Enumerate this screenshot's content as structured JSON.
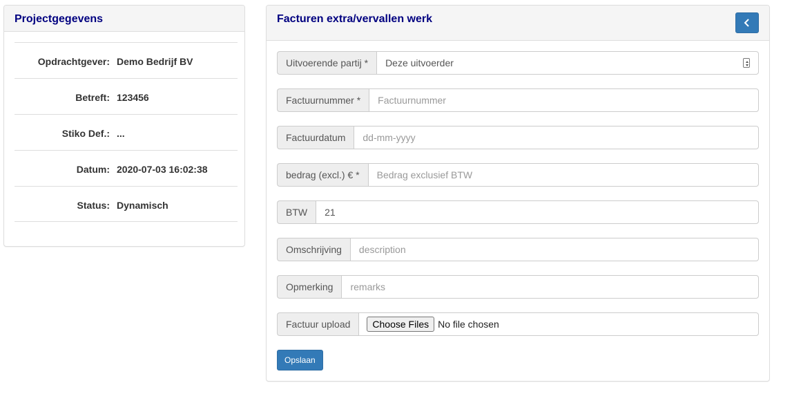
{
  "project_panel": {
    "title": "Projectgegevens",
    "rows": [
      {
        "label": "Opdrachtgever:",
        "value": "Demo Bedrijf BV"
      },
      {
        "label": "Betreft:",
        "value": "123456"
      },
      {
        "label": "Stiko Def.:",
        "value": "..."
      },
      {
        "label": "Datum:",
        "value": "2020-07-03 16:02:38"
      },
      {
        "label": "Status:",
        "value": "Dynamisch"
      }
    ]
  },
  "invoice_panel": {
    "title": "Facturen extra/vervallen werk",
    "back_icon": "chevron-left-icon",
    "fields": {
      "party": {
        "label": "Uitvoerende partij *",
        "value": "Deze uitvoerder"
      },
      "invoice_number": {
        "label": "Factuurnummer *",
        "placeholder": "Factuurnummer",
        "value": ""
      },
      "invoice_date": {
        "label": "Factuurdatum",
        "placeholder": "dd-mm-yyyy",
        "value": ""
      },
      "amount": {
        "label": "bedrag (excl.) € *",
        "placeholder": "Bedrag exclusief BTW",
        "value": ""
      },
      "vat": {
        "label": "BTW",
        "value": "21"
      },
      "description": {
        "label": "Omschrijving",
        "placeholder": "description",
        "value": ""
      },
      "remarks": {
        "label": "Opmerking",
        "placeholder": "remarks",
        "value": ""
      },
      "upload": {
        "label": "Factuur upload",
        "button_label": "Choose Files",
        "status": "No file chosen"
      }
    },
    "save_label": "Opslaan"
  },
  "colors": {
    "title": "#000080",
    "primary": "#337ab7",
    "addon_bg": "#eeeeee",
    "border": "#cccccc"
  }
}
